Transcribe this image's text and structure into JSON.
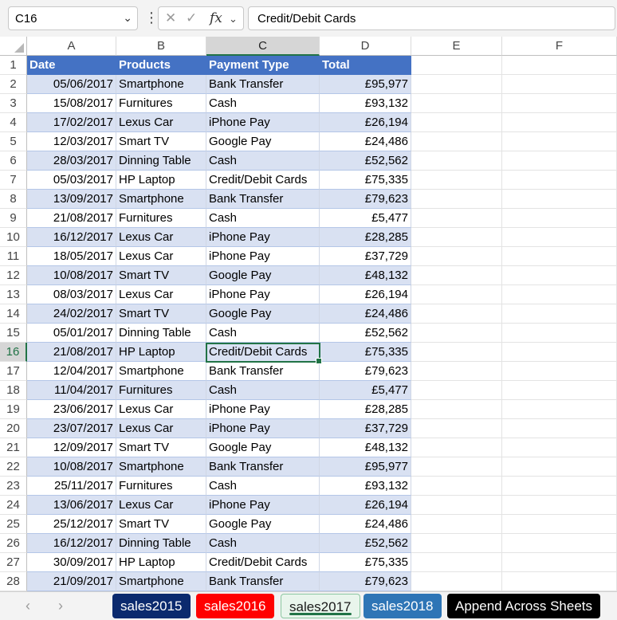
{
  "formula_bar": {
    "name_box": "C16",
    "formula": "Credit/Debit Cards"
  },
  "columns": [
    "A",
    "B",
    "C",
    "D",
    "E",
    "F"
  ],
  "table": {
    "headers": [
      "Date",
      "Products",
      "Payment Type",
      "Total"
    ],
    "rows": [
      [
        "05/06/2017",
        "Smartphone",
        "Bank Transfer",
        "£95,977"
      ],
      [
        "15/08/2017",
        "Furnitures",
        "Cash",
        "£93,132"
      ],
      [
        "17/02/2017",
        "Lexus Car",
        "iPhone Pay",
        "£26,194"
      ],
      [
        "12/03/2017",
        "Smart TV",
        "Google Pay",
        "£24,486"
      ],
      [
        "28/03/2017",
        "Dinning Table",
        "Cash",
        "£52,562"
      ],
      [
        "05/03/2017",
        "HP Laptop",
        "Credit/Debit Cards",
        "£75,335"
      ],
      [
        "13/09/2017",
        "Smartphone",
        "Bank Transfer",
        "£79,623"
      ],
      [
        "21/08/2017",
        "Furnitures",
        "Cash",
        "£5,477"
      ],
      [
        "16/12/2017",
        "Lexus Car",
        "iPhone Pay",
        "£28,285"
      ],
      [
        "18/05/2017",
        "Lexus Car",
        "iPhone Pay",
        "£37,729"
      ],
      [
        "10/08/2017",
        "Smart TV",
        "Google Pay",
        "£48,132"
      ],
      [
        "08/03/2017",
        "Lexus Car",
        "iPhone Pay",
        "£26,194"
      ],
      [
        "24/02/2017",
        "Smart TV",
        "Google Pay",
        "£24,486"
      ],
      [
        "05/01/2017",
        "Dinning Table",
        "Cash",
        "£52,562"
      ],
      [
        "21/08/2017",
        "HP Laptop",
        "Credit/Debit Cards",
        "£75,335"
      ],
      [
        "12/04/2017",
        "Smartphone",
        "Bank Transfer",
        "£79,623"
      ],
      [
        "11/04/2017",
        "Furnitures",
        "Cash",
        "£5,477"
      ],
      [
        "23/06/2017",
        "Lexus Car",
        "iPhone Pay",
        "£28,285"
      ],
      [
        "23/07/2017",
        "Lexus Car",
        "iPhone Pay",
        "£37,729"
      ],
      [
        "12/09/2017",
        "Smart TV",
        "Google Pay",
        "£48,132"
      ],
      [
        "10/08/2017",
        "Smartphone",
        "Bank Transfer",
        "£95,977"
      ],
      [
        "25/11/2017",
        "Furnitures",
        "Cash",
        "£93,132"
      ],
      [
        "13/06/2017",
        "Lexus Car",
        "iPhone Pay",
        "£26,194"
      ],
      [
        "25/12/2017",
        "Smart TV",
        "Google Pay",
        "£24,486"
      ],
      [
        "16/12/2017",
        "Dinning Table",
        "Cash",
        "£52,562"
      ],
      [
        "30/09/2017",
        "HP Laptop",
        "Credit/Debit Cards",
        "£75,335"
      ],
      [
        "21/09/2017",
        "Smartphone",
        "Bank Transfer",
        "£79,623"
      ]
    ]
  },
  "selected_cell": {
    "column": "C",
    "row": 16
  },
  "sheet_tabs": [
    {
      "label": "sales2015",
      "bg": "#0b2a6e",
      "color": "#ffffff",
      "active": false
    },
    {
      "label": "sales2016",
      "bg": "#ff0000",
      "color": "#ffffff",
      "active": false
    },
    {
      "label": "sales2017",
      "bg": "#e9f5ec",
      "color": "#1a1a1a",
      "active": true
    },
    {
      "label": "sales2018",
      "bg": "#2e75b6",
      "color": "#ffffff",
      "active": false
    },
    {
      "label": "Append Across Sheets",
      "bg": "#000000",
      "color": "#ffffff",
      "active": false
    }
  ],
  "colors": {
    "header_fill": "#4472c4",
    "band_fill": "#d9e1f2",
    "selection": "#217346"
  }
}
